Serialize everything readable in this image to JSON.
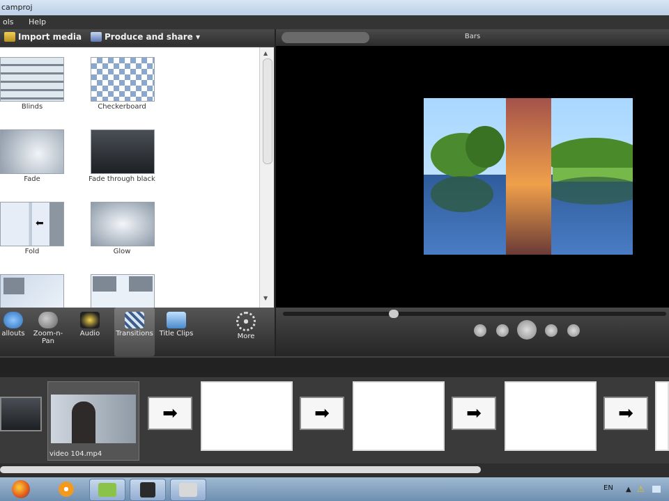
{
  "window": {
    "title_fragment": "camproj"
  },
  "menu": {
    "items": [
      "ols",
      "Help"
    ]
  },
  "left_toolbar": {
    "import_media": "Import media",
    "produce_share": "Produce and share ▾"
  },
  "transitions": [
    {
      "label": "Blinds"
    },
    {
      "label": "Checkerboard"
    },
    {
      "label": "Fade"
    },
    {
      "label": "Fade through black"
    },
    {
      "label": "Fold"
    },
    {
      "label": "Glow"
    }
  ],
  "task_tabs": [
    {
      "label": "allouts"
    },
    {
      "label": "Zoom-n-Pan"
    },
    {
      "label": "Audio"
    },
    {
      "label": "Transitions",
      "selected": true
    },
    {
      "label": "Title Clips"
    },
    {
      "label": "More"
    }
  ],
  "preview": {
    "title": "Bars"
  },
  "storyboard": {
    "clip_name": "video 104.mp4"
  },
  "taskbar": {
    "lang": "EN"
  },
  "colors": {
    "panel_bg": "#3b3b3b",
    "preview_bg": "#000000",
    "accent_taskbar": "#7f9fc1"
  }
}
